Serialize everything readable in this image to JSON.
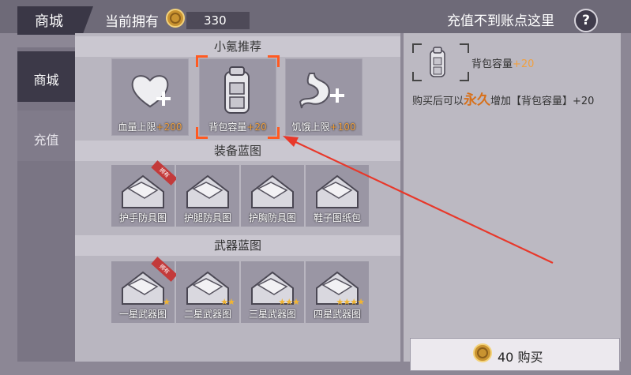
{
  "header": {
    "title": "商城",
    "owned_label": "当前拥有",
    "coin_count": "330",
    "recharge_issue": "充值不到账点这里",
    "help_icon": "?"
  },
  "sidebar": {
    "items": [
      {
        "label": "商城",
        "selected": true
      },
      {
        "label": "充值",
        "selected": false
      }
    ]
  },
  "sections": {
    "recommend": {
      "title": "小氪推荐",
      "items": [
        {
          "name": "血量上限",
          "bonus": "+200",
          "icon": "heart-plus-icon"
        },
        {
          "name": "背包容量",
          "bonus": "+20",
          "icon": "backpack-icon",
          "selected": true
        },
        {
          "name": "饥饿上限",
          "bonus": "+100",
          "icon": "stomach-plus-icon"
        }
      ]
    },
    "equipment": {
      "title": "装备蓝图",
      "items": [
        {
          "name": "护手防具图",
          "owned_tag": "拥有"
        },
        {
          "name": "护腿防具图"
        },
        {
          "name": "护胸防具图"
        },
        {
          "name": "鞋子图纸包"
        }
      ]
    },
    "weapons": {
      "title": "武器蓝图",
      "items": [
        {
          "name": "一星武器图",
          "stars": 1,
          "owned_tag": "拥有"
        },
        {
          "name": "二星武器图",
          "stars": 2
        },
        {
          "name": "三星武器图",
          "stars": 3
        },
        {
          "name": "四星武器图",
          "stars": 4
        }
      ]
    }
  },
  "detail": {
    "name": "背包容量",
    "bonus": "+20",
    "desc_prefix": "购买后可以",
    "desc_permanent": "永久",
    "desc_suffix": "增加【背包容量】+20",
    "buy_amount": "40",
    "buy_label": "购买"
  },
  "colors": {
    "accent_selection": "#ff5a22",
    "bonus_text": "#f0a040",
    "permanent_text": "#d7701a",
    "star": "#f2b531",
    "annotation_arrow": "#e8382a"
  }
}
